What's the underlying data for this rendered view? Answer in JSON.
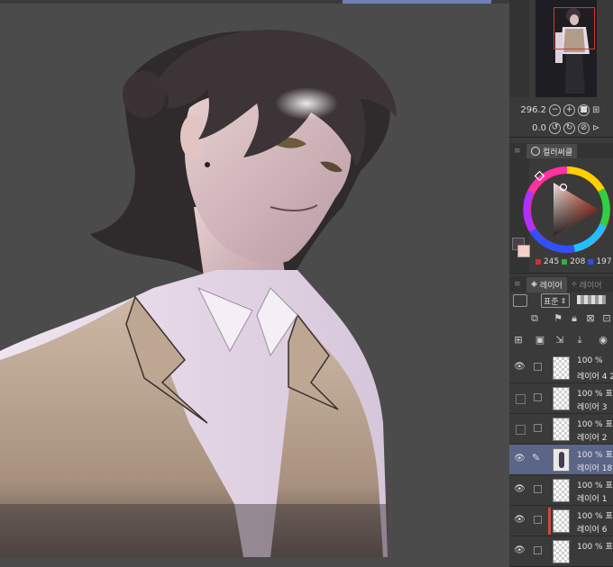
{
  "navigator": {
    "zoom_value": "296.2",
    "rotation_value": "0.0"
  },
  "color_panel": {
    "tab_label": "컬러써클",
    "rgb": {
      "r": "245",
      "g": "208",
      "b": "197"
    },
    "colors": {
      "main": "#f5d0c5",
      "wheel_hue": "#d4452b"
    }
  },
  "layer_panel": {
    "tab_label": "레이어",
    "tab2_label": "레이어",
    "blend_mode": "표준",
    "layers": [
      {
        "opacity": "100 %",
        "name": "레이어 4 2",
        "visible": true,
        "selected": false,
        "clip": false,
        "thumb": "checker"
      },
      {
        "opacity": "100 % 표",
        "name": "레이어 3",
        "visible": false,
        "selected": false,
        "clip": false,
        "thumb": "checker"
      },
      {
        "opacity": "100 % 표",
        "name": "레이어 2",
        "visible": false,
        "selected": false,
        "clip": false,
        "thumb": "checker"
      },
      {
        "opacity": "100 % 표",
        "name": "레이어 18",
        "visible": true,
        "selected": true,
        "clip": false,
        "thumb": "figure"
      },
      {
        "opacity": "100 % 표",
        "name": "레이어 1",
        "visible": true,
        "selected": false,
        "clip": false,
        "thumb": "checker"
      },
      {
        "opacity": "100 % 표",
        "name": "레이어 6",
        "visible": true,
        "selected": false,
        "clip": true,
        "thumb": "checker"
      },
      {
        "opacity": "100 % 표",
        "name": "",
        "visible": true,
        "selected": false,
        "clip": false,
        "thumb": "checker"
      }
    ]
  }
}
